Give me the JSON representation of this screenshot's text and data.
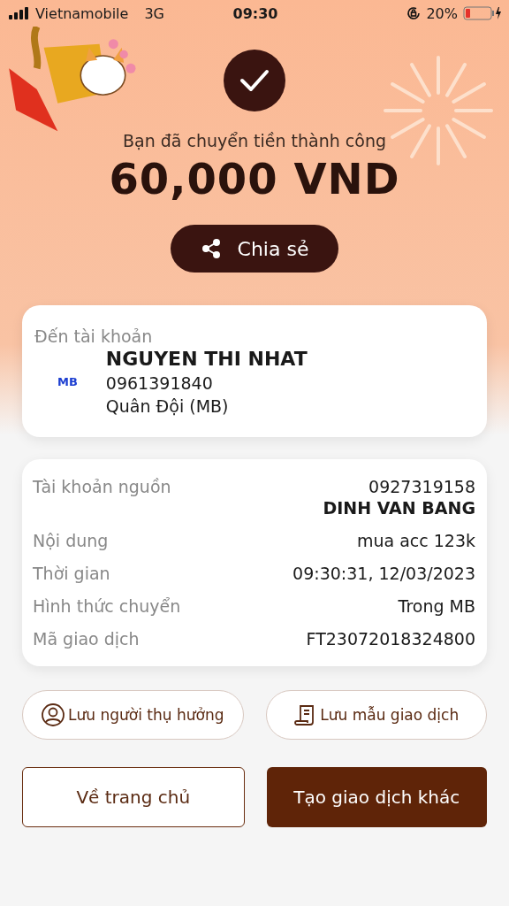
{
  "status_bar": {
    "carrier": "Vietnamobile",
    "network": "3G",
    "time": "09:30",
    "battery": "20%"
  },
  "result": {
    "message": "Bạn đã chuyển tiền thành công",
    "amount": "60,000 VND",
    "share_button": "Chia sẻ"
  },
  "recipient": {
    "label": "Đến tài khoản",
    "bank_logo": "MB",
    "name": "NGUYEN THI NHAT",
    "account": "0961391840",
    "bank": "Quân Đội (MB)"
  },
  "details": [
    {
      "label": "Tài khoản nguồn",
      "values": [
        "0927319158",
        "DINH VAN BANG"
      ]
    },
    {
      "label": "Nội dung",
      "values": [
        "mua acc 123k"
      ]
    },
    {
      "label": "Thời gian",
      "values": [
        "09:30:31, 12/03/2023"
      ]
    },
    {
      "label": "Hình thức chuyển",
      "values": [
        "Trong MB"
      ]
    },
    {
      "label": "Mã giao dịch",
      "values": [
        "FT23072018324800"
      ]
    }
  ],
  "actions": [
    {
      "kind": "person",
      "label": "Lưu người thụ hưởng"
    },
    {
      "kind": "template",
      "label": "Lưu mẫu giao dịch"
    }
  ],
  "buttons": [
    {
      "kind": "outline",
      "label": "Về trang chủ"
    },
    {
      "kind": "filled",
      "label": "Tạo giao dịch khác"
    }
  ]
}
